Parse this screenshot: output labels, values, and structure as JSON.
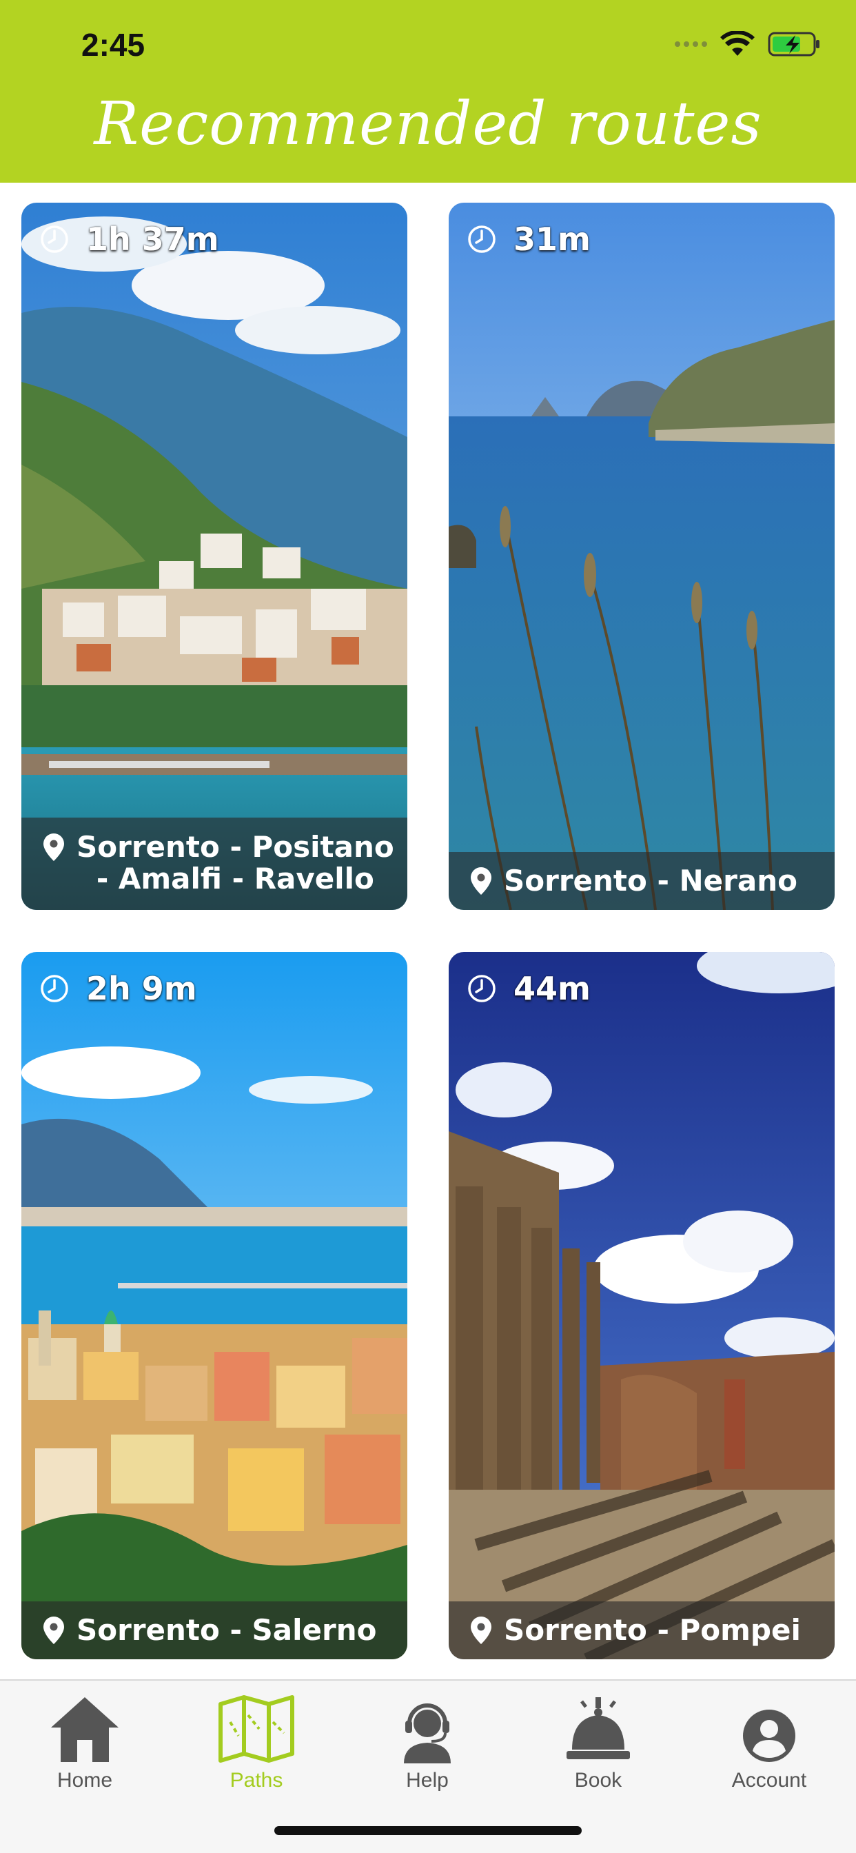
{
  "status": {
    "time": "2:45"
  },
  "header": {
    "title": "Recommended routes"
  },
  "colors": {
    "accent": "#b3d322",
    "tab_active": "#a3cc1f",
    "tab_inactive": "#555555"
  },
  "routes": [
    {
      "duration": "1h 37m",
      "name_line1": "Sorrento - Positano",
      "name_line2": "- Amalfi - Ravello"
    },
    {
      "duration": "31m",
      "name_line1": "Sorrento - Nerano"
    },
    {
      "duration": "2h 9m",
      "name_line1": "Sorrento - Salerno"
    },
    {
      "duration": "44m",
      "name_line1": "Sorrento - Pompei"
    }
  ],
  "tabs": [
    {
      "label": "Home",
      "icon": "house-icon",
      "active": false
    },
    {
      "label": "Paths",
      "icon": "map-icon",
      "active": true
    },
    {
      "label": "Help",
      "icon": "support-agent-icon",
      "active": false
    },
    {
      "label": "Book",
      "icon": "service-bell-icon",
      "active": false
    },
    {
      "label": "Account",
      "icon": "account-circle-icon",
      "active": false
    }
  ]
}
